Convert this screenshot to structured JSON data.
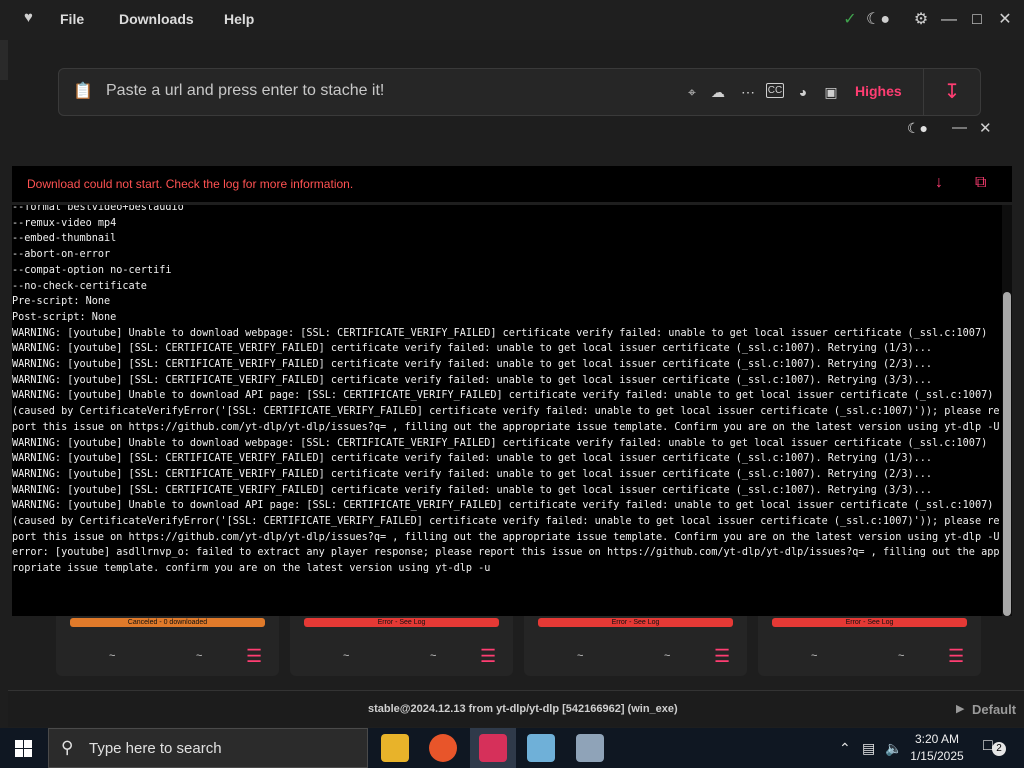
{
  "menu": {
    "file": "File",
    "downloads": "Downloads",
    "help": "Help"
  },
  "url_bar": {
    "placeholder": "Paste a url and press enter to stache it!",
    "quality": "Highes"
  },
  "error_banner": {
    "message": "Download could not start. Check the log for more information."
  },
  "log_text": "--format bestvideo+bestaudio\n--remux-video mp4\n--embed-thumbnail\n--abort-on-error\n--compat-option no-certifi\n--no-check-certificate\nPre-script: None\nPost-script: None\nWARNING: [youtube] Unable to download webpage: [SSL: CERTIFICATE_VERIFY_FAILED] certificate verify failed: unable to get local issuer certificate (_ssl.c:1007)\nWARNING: [youtube] [SSL: CERTIFICATE_VERIFY_FAILED] certificate verify failed: unable to get local issuer certificate (_ssl.c:1007). Retrying (1/3)...\nWARNING: [youtube] [SSL: CERTIFICATE_VERIFY_FAILED] certificate verify failed: unable to get local issuer certificate (_ssl.c:1007). Retrying (2/3)...\nWARNING: [youtube] [SSL: CERTIFICATE_VERIFY_FAILED] certificate verify failed: unable to get local issuer certificate (_ssl.c:1007). Retrying (3/3)...\nWARNING: [youtube] Unable to download API page: [SSL: CERTIFICATE_VERIFY_FAILED] certificate verify failed: unable to get local issuer certificate (_ssl.c:1007) (caused by CertificateVerifyError('[SSL: CERTIFICATE_VERIFY_FAILED] certificate verify failed: unable to get local issuer certificate (_ssl.c:1007)')); please report this issue on https://github.com/yt-dlp/yt-dlp/issues?q= , filling out the appropriate issue template. Confirm you are on the latest version using yt-dlp -U\nWARNING: [youtube] Unable to download webpage: [SSL: CERTIFICATE_VERIFY_FAILED] certificate verify failed: unable to get local issuer certificate (_ssl.c:1007)\nWARNING: [youtube] [SSL: CERTIFICATE_VERIFY_FAILED] certificate verify failed: unable to get local issuer certificate (_ssl.c:1007). Retrying (1/3)...\nWARNING: [youtube] [SSL: CERTIFICATE_VERIFY_FAILED] certificate verify failed: unable to get local issuer certificate (_ssl.c:1007). Retrying (2/3)...\nWARNING: [youtube] [SSL: CERTIFICATE_VERIFY_FAILED] certificate verify failed: unable to get local issuer certificate (_ssl.c:1007). Retrying (3/3)...\nWARNING: [youtube] Unable to download API page: [SSL: CERTIFICATE_VERIFY_FAILED] certificate verify failed: unable to get local issuer certificate (_ssl.c:1007) (caused by CertificateVerifyError('[SSL: CERTIFICATE_VERIFY_FAILED] certificate verify failed: unable to get local issuer certificate (_ssl.c:1007)')); please report this issue on https://github.com/yt-dlp/yt-dlp/issues?q= , filling out the appropriate issue template. Confirm you are on the latest version using yt-dlp -U\nerror: [youtube] asdllrnvp_o: failed to extract any player response; please report this issue on https://github.com/yt-dlp/yt-dlp/issues?q= , filling out the appropriate issue template. confirm you are on the latest version using yt-dlp -u",
  "cards": [
    {
      "status": "Canceled - 0 downloaded",
      "color": "#e07a2a",
      "left": "~",
      "right": "~"
    },
    {
      "status": "Error - See Log",
      "color": "#e53935",
      "left": "~",
      "right": "~"
    },
    {
      "status": "Error - See Log",
      "color": "#e53935",
      "left": "~",
      "right": "~"
    },
    {
      "status": "Error - See Log",
      "color": "#e53935",
      "left": "~",
      "right": "~"
    }
  ],
  "footer": {
    "version": "stable@2024.12.13 from yt-dlp/yt-dlp [542166962] (win_exe)",
    "theme": "Default"
  },
  "taskbar": {
    "search_placeholder": "Type here to search",
    "time": "3:20 AM",
    "date": "1/15/2025",
    "notification_count": "2"
  },
  "colors": {
    "accent": "#ff3d72",
    "error": "#ff5252"
  }
}
